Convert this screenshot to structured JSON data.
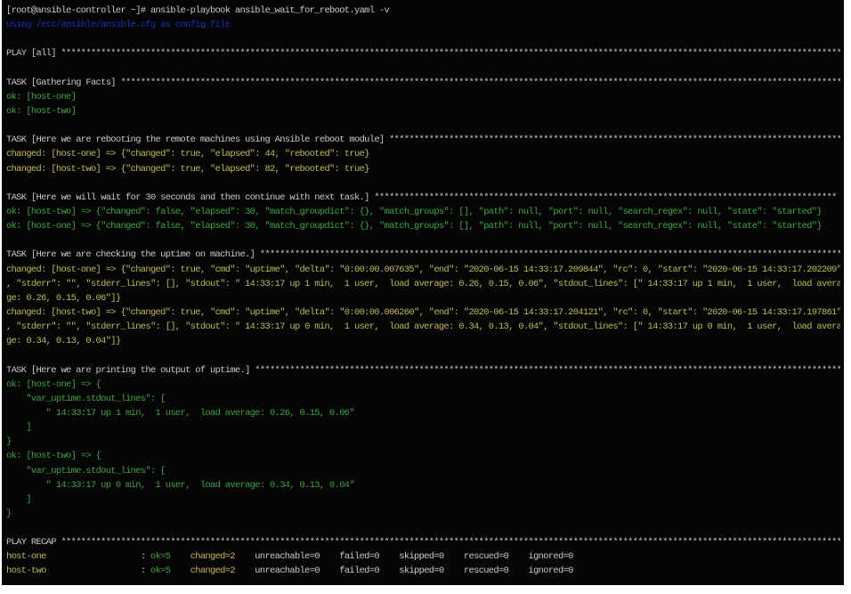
{
  "window": {
    "title": "root@ansible-controller terminal"
  },
  "colors": {
    "default": "#c9c9c9",
    "ok": "#41a341",
    "changed": "#c2b95a",
    "info": "#1c2fb8",
    "background": "#050505"
  },
  "lines": [
    [
      {
        "t": "[root@ansible-controller ~]# ansible-playbook ansible_wait_for_reboot.yaml -v",
        "c": "d"
      }
    ],
    [
      {
        "t": "Using /etc/ansible/ansible.cfg as config file",
        "c": "b"
      }
    ],
    [],
    [
      {
        "t": "PLAY [all] *************************************************************************************************************************************************************",
        "c": "d"
      }
    ],
    [],
    [
      {
        "t": "TASK [Gathering Facts] *************************************************************************************************************************************************",
        "c": "d"
      }
    ],
    [
      {
        "t": "ok: [host-one]",
        "c": "g"
      }
    ],
    [
      {
        "t": "ok: [host-two]",
        "c": "g"
      }
    ],
    [],
    [
      {
        "t": "TASK [Here we are rebooting the remote machines using Ansible reboot module] *******************************************************************************************",
        "c": "d"
      }
    ],
    [
      {
        "t": "changed: [host-one] => {\"changed\": true, \"elapsed\": 44, \"rebooted\": true}",
        "c": "y"
      }
    ],
    [
      {
        "t": "changed: [host-two] => {\"changed\": true, \"elapsed\": 82, \"rebooted\": true}",
        "c": "y"
      }
    ],
    [],
    [
      {
        "t": "TASK [Here we will wait for 30 seconds and then continue with next task.] *********************************************************************************************",
        "c": "d"
      }
    ],
    [
      {
        "t": "ok: [host-two] => {\"changed\": false, \"elapsed\": 30, \"match_groupdict\": {}, \"match_groups\": [], \"path\": null, \"port\": null, \"search_regex\": null, \"state\": \"started\"}",
        "c": "g"
      }
    ],
    [
      {
        "t": "ok: [host-one] => {\"changed\": false, \"elapsed\": 30, \"match_groupdict\": {}, \"match_groups\": [], \"path\": null, \"port\": null, \"search_regex\": null, \"state\": \"started\"}",
        "c": "g"
      }
    ],
    [],
    [
      {
        "t": "TASK [Here we are checking the uptime on machine.] *********************************************************************************************************************",
        "c": "d"
      }
    ],
    [
      {
        "t": "changed: [host-one] => {\"changed\": true, \"cmd\": \"uptime\", \"delta\": \"0:00:00.007635\", \"end\": \"2020-06-15 14:33:17.209844\", \"rc\": 0, \"start\": \"2020-06-15 14:33:17.202209\"",
        "c": "y"
      }
    ],
    [
      {
        "t": ", \"stderr\": \"\", \"stderr_lines\": [], \"stdout\": \" 14:33:17 up 1 min,  1 user,  load average: 0.26, 0.15, 0.06\", \"stdout_lines\": [\" 14:33:17 up 1 min,  1 user,  load avera",
        "c": "y"
      }
    ],
    [
      {
        "t": "ge: 0.26, 0.15, 0.06\"]}",
        "c": "y"
      }
    ],
    [
      {
        "t": "changed: [host-two] => {\"changed\": true, \"cmd\": \"uptime\", \"delta\": \"0:00:00.006260\", \"end\": \"2020-06-15 14:33:17.204121\", \"rc\": 0, \"start\": \"2020-06-15 14:33:17.197861\"",
        "c": "y"
      }
    ],
    [
      {
        "t": ", \"stderr\": \"\", \"stderr_lines\": [], \"stdout\": \" 14:33:17 up 0 min,  1 user,  load average: 0.34, 0.13, 0.04\", \"stdout_lines\": [\" 14:33:17 up 0 min,  1 user,  load avera",
        "c": "y"
      }
    ],
    [
      {
        "t": "ge: 0.34, 0.13, 0.04\"]}",
        "c": "y"
      }
    ],
    [],
    [
      {
        "t": "TASK [Here we are printing the output of uptime.] **********************************************************************************************************************",
        "c": "d"
      }
    ],
    [
      {
        "t": "ok: [host-one] => {",
        "c": "g"
      }
    ],
    [
      {
        "t": "    \"var_uptime.stdout_lines\": [",
        "c": "g"
      }
    ],
    [
      {
        "t": "        \" 14:33:17 up 1 min,  1 user,  load average: 0.26, 0.15, 0.06\"",
        "c": "g"
      }
    ],
    [
      {
        "t": "    ]",
        "c": "g"
      }
    ],
    [
      {
        "t": "}",
        "c": "g"
      }
    ],
    [
      {
        "t": "ok: [host-two] => {",
        "c": "g"
      }
    ],
    [
      {
        "t": "    \"var_uptime.stdout_lines\": [",
        "c": "g"
      }
    ],
    [
      {
        "t": "        \" 14:33:17 up 0 min,  1 user,  load average: 0.34, 0.13, 0.04\"",
        "c": "g"
      }
    ],
    [
      {
        "t": "    ]",
        "c": "g"
      }
    ],
    [
      {
        "t": "}",
        "c": "g"
      }
    ],
    [],
    [
      {
        "t": "PLAY RECAP *************************************************************************************************************************************************************",
        "c": "d"
      }
    ],
    [
      {
        "t": "host-one                   ",
        "c": "y"
      },
      {
        "t": ": ",
        "c": "d"
      },
      {
        "t": "ok=5",
        "c": "g"
      },
      {
        "t": "    ",
        "c": "d"
      },
      {
        "t": "changed=2",
        "c": "y"
      },
      {
        "t": "    unreachable=0    failed=0    skipped=0    rescued=0    ignored=0",
        "c": "d"
      }
    ],
    [
      {
        "t": "host-two                   ",
        "c": "y"
      },
      {
        "t": ": ",
        "c": "d"
      },
      {
        "t": "ok=5",
        "c": "g"
      },
      {
        "t": "    ",
        "c": "d"
      },
      {
        "t": "changed=2",
        "c": "y"
      },
      {
        "t": "    unreachable=0    failed=0    skipped=0    rescued=0    ignored=0",
        "c": "d"
      }
    ]
  ]
}
